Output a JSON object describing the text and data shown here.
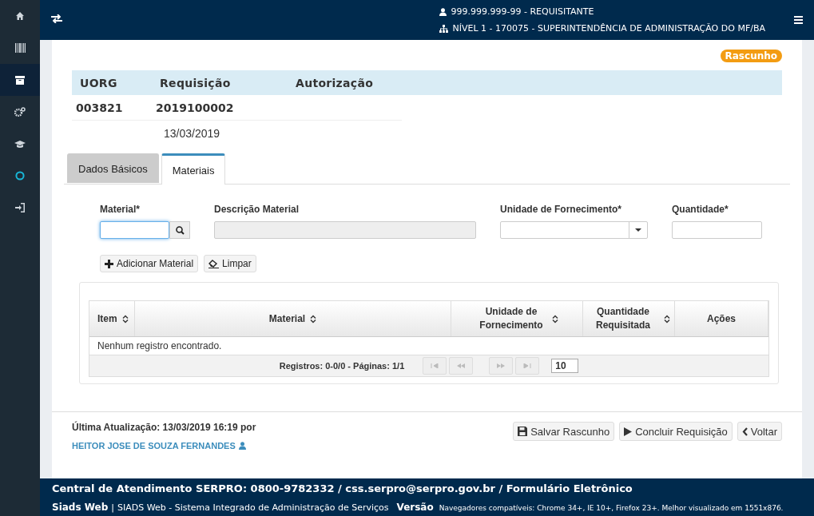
{
  "sidebar": {
    "items": [
      {
        "kind": "home",
        "selected": false
      },
      {
        "kind": "barcode",
        "selected": false
      },
      {
        "kind": "box",
        "selected": true
      },
      {
        "kind": "gears",
        "selected": false
      },
      {
        "kind": "cap",
        "selected": false
      },
      {
        "kind": "circle",
        "selected": false
      },
      {
        "kind": "signin",
        "selected": false
      }
    ]
  },
  "header": {
    "user": "999.999.999-99 - REQUISITANTE",
    "unit": "NÍVEL 1 - 170075 - SUPERINTENDÊNCIA DE ADMINISTRAÇÃO DO MF/BA"
  },
  "status_badge": "Rascunho",
  "summary": {
    "columns": [
      "UORG",
      "Requisição",
      "Autorização"
    ],
    "values": [
      "003821",
      "2019100002"
    ],
    "date": "13/03/2019"
  },
  "tabs": [
    {
      "label": "Dados Básicos",
      "selected": false
    },
    {
      "label": "Materiais",
      "selected": true
    }
  ],
  "form": {
    "fields": [
      {
        "kind": "search",
        "label": "Material*"
      },
      {
        "kind": "readonly",
        "label": "Descrição Material"
      },
      {
        "kind": "select",
        "label": "Unidade de Fornecimento*"
      },
      {
        "kind": "text",
        "label": "Quantidade*"
      }
    ],
    "buttons": [
      {
        "kind": "plus",
        "label": "Adicionar Material"
      },
      {
        "kind": "eraser",
        "label": "Limpar"
      }
    ]
  },
  "table": {
    "columns": [
      {
        "label": "Item",
        "sortable": true
      },
      {
        "label": "Material",
        "sortable": true
      },
      {
        "label": "Unidade de Fornecimento",
        "sortable": true
      },
      {
        "label": "Quantidade Requisitada",
        "sortable": true
      },
      {
        "label": "Ações",
        "sortable": false
      }
    ],
    "empty_message": "Nenhum registro encontrado.",
    "pagination": {
      "summary": "Registros: 0-0/0 - Páginas: 1/1",
      "page_size": "10"
    }
  },
  "footer_info": {
    "updated": "Última Atualização: 13/03/2019 16:19 por",
    "user": "HEITOR JOSE DE SOUZA FERNANDES"
  },
  "actions": [
    {
      "kind": "save",
      "label": "Salvar Rascunho"
    },
    {
      "kind": "play",
      "label": "Concluir Requisição"
    },
    {
      "kind": "back",
      "label": "Voltar"
    }
  ],
  "footer": {
    "contact": "Central de Atendimento SERPRO: 0800-9782332 / css.serpro@serpro.gov.br / Formulário Eletrônico",
    "app": "Siads Web",
    "separator": "|",
    "system": "SIADS Web - Sistema Integrado de Administração de Serviços",
    "version_label": "Versão",
    "browsers": "Navegadores compatíveis: Chrome 34+, IE 10+, Firefox 23+. Melhor visualizado em 1551x876."
  }
}
